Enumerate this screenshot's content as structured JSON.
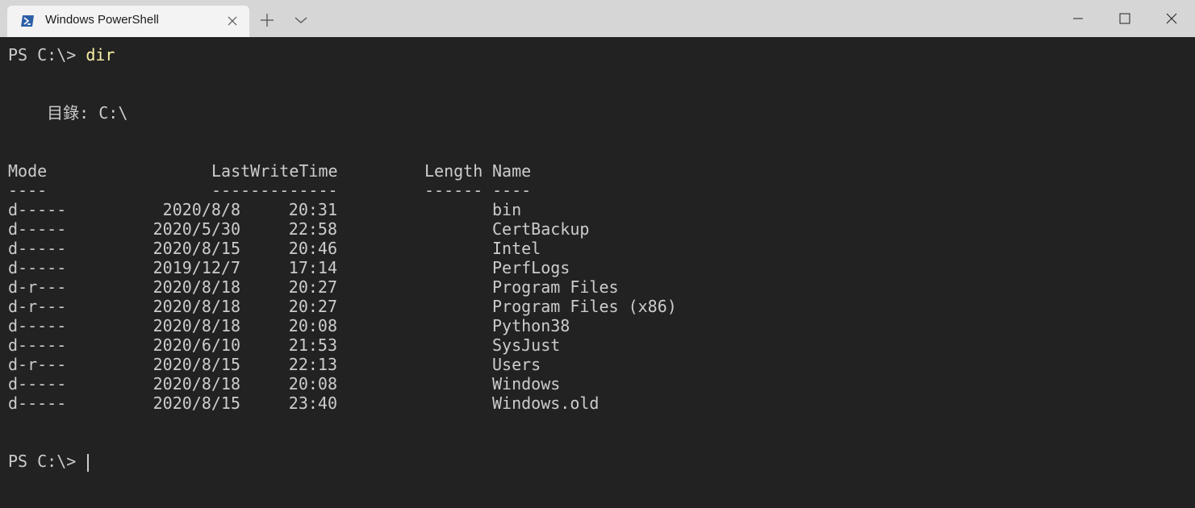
{
  "tab": {
    "title": "Windows PowerShell",
    "icon": "powershell-icon"
  },
  "titlebar": {
    "new_tab_icon": "plus-icon",
    "dropdown_icon": "chevron-down-icon",
    "minimize_icon": "minimize-icon",
    "maximize_icon": "maximize-icon",
    "close_icon": "close-icon"
  },
  "terminal": {
    "prompt1": "PS C:\\> ",
    "command1": "dir",
    "directory_label": "    目錄: C:\\",
    "headers": {
      "mode": "Mode",
      "lastwritetime": "LastWriteTime",
      "length": "Length",
      "name": "Name"
    },
    "separators": {
      "mode": "----",
      "lastwritetime": "-------------",
      "length": "------",
      "name": "----"
    },
    "rows": [
      {
        "mode": "d-----",
        "date": "2020/8/8",
        "time": "20:31",
        "name": "bin"
      },
      {
        "mode": "d-----",
        "date": "2020/5/30",
        "time": "22:58",
        "name": "CertBackup"
      },
      {
        "mode": "d-----",
        "date": "2020/8/15",
        "time": "20:46",
        "name": "Intel"
      },
      {
        "mode": "d-----",
        "date": "2019/12/7",
        "time": "17:14",
        "name": "PerfLogs"
      },
      {
        "mode": "d-r---",
        "date": "2020/8/18",
        "time": "20:27",
        "name": "Program Files"
      },
      {
        "mode": "d-r---",
        "date": "2020/8/18",
        "time": "20:27",
        "name": "Program Files (x86)"
      },
      {
        "mode": "d-----",
        "date": "2020/8/18",
        "time": "20:08",
        "name": "Python38"
      },
      {
        "mode": "d-----",
        "date": "2020/6/10",
        "time": "21:53",
        "name": "SysJust"
      },
      {
        "mode": "d-r---",
        "date": "2020/8/15",
        "time": "22:13",
        "name": "Users"
      },
      {
        "mode": "d-----",
        "date": "2020/8/18",
        "time": "20:08",
        "name": "Windows"
      },
      {
        "mode": "d-----",
        "date": "2020/8/15",
        "time": "23:40",
        "name": "Windows.old"
      }
    ],
    "prompt2": "PS C:\\> "
  },
  "colors": {
    "background": "#222222",
    "foreground": "#cccccc",
    "command": "#f9f1a5",
    "titlebar": "#d6d6d6",
    "tab": "#f3f3f3"
  }
}
